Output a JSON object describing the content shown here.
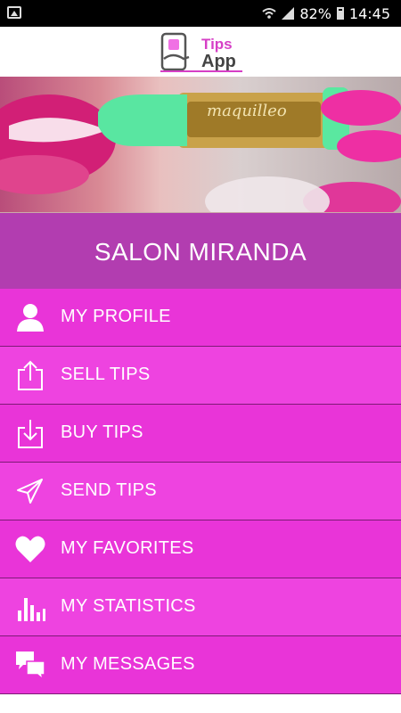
{
  "status_bar": {
    "battery": "82%",
    "time": "14:45"
  },
  "app_bar": {
    "logo_line1": "Tips",
    "logo_line2": "App"
  },
  "banner": {
    "brand_text": "maquilleo"
  },
  "salon_name": "SALON MIRANDA",
  "menu": {
    "items": [
      {
        "label": "MY PROFILE",
        "icon": "person-icon"
      },
      {
        "label": "SELL TIPS",
        "icon": "upload-icon"
      },
      {
        "label": "BUY TIPS",
        "icon": "download-icon"
      },
      {
        "label": "SEND TIPS",
        "icon": "send-icon"
      },
      {
        "label": "MY FAVORITES",
        "icon": "heart-icon"
      },
      {
        "label": "MY STATISTICS",
        "icon": "bar-chart-icon"
      },
      {
        "label": "MY MESSAGES",
        "icon": "messages-icon"
      }
    ]
  },
  "colors": {
    "accent": "#e934d8",
    "header": "#b23db0",
    "logo_pink": "#d63fc6"
  }
}
